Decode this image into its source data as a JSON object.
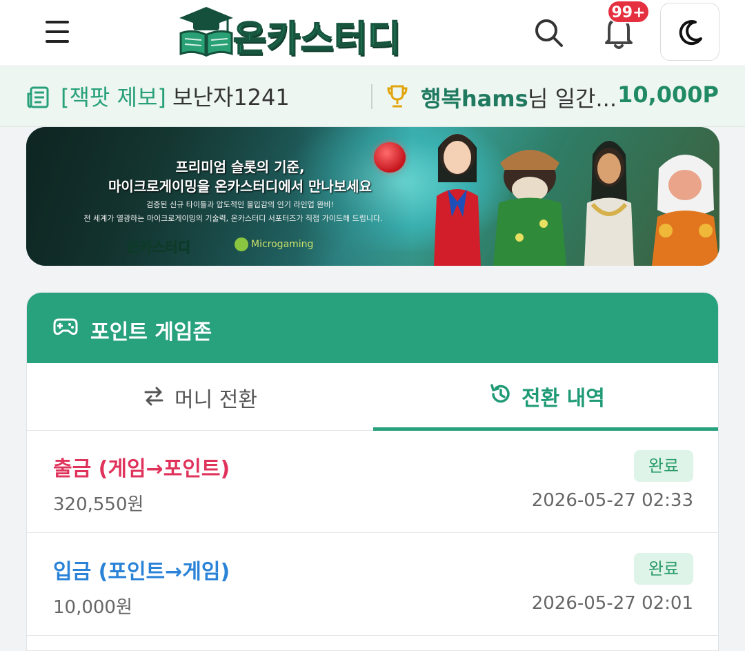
{
  "header": {
    "logo_text": "온카스터디",
    "notification_count": "99+"
  },
  "ticker": {
    "tag": "[잭팟 제보]",
    "text": "보난자1241",
    "user": "행복hams",
    "suffix": "님 일간...",
    "points": "10,000P"
  },
  "banner": {
    "headline_1": "프리미엄 슬롯의 기준,",
    "headline_2": "마이크로게이밍을 온카스터디에서 만나보세요",
    "sub_1": "검증된 신규 타이틀과 압도적인 몰입감의 인기 라인업 완비!",
    "sub_2": "전 세계가 열광하는 마이크로게이밍의 기술력, 온카스터디 서포터즈가 직접 가이드해 드립니다.",
    "logo_text": "온카스터디",
    "partner_text": "Microgaming"
  },
  "zone": {
    "title": "포인트 게임존",
    "tabs": [
      {
        "label": "머니 전환",
        "active": false
      },
      {
        "label": "전환 내역",
        "active": true
      }
    ],
    "history": [
      {
        "title": "출금 (게임→포인트)",
        "type": "withdraw",
        "amount": "320,550원",
        "time": "2026-05-27 02:33",
        "status": "완료"
      },
      {
        "title": "입금 (포인트→게임)",
        "type": "deposit",
        "amount": "10,000원",
        "time": "2026-05-27 02:01",
        "status": "완료"
      }
    ]
  },
  "colors": {
    "brand_green": "#28a17d",
    "withdraw_red": "#e0335c",
    "deposit_blue": "#2b83d8",
    "badge_red": "#e5303f"
  },
  "icons": [
    "menu-icon",
    "logo-book-icon",
    "search-icon",
    "bell-icon",
    "moon-icon",
    "newspaper-icon",
    "trophy-icon",
    "gamepad-icon",
    "swap-icon",
    "history-icon"
  ]
}
